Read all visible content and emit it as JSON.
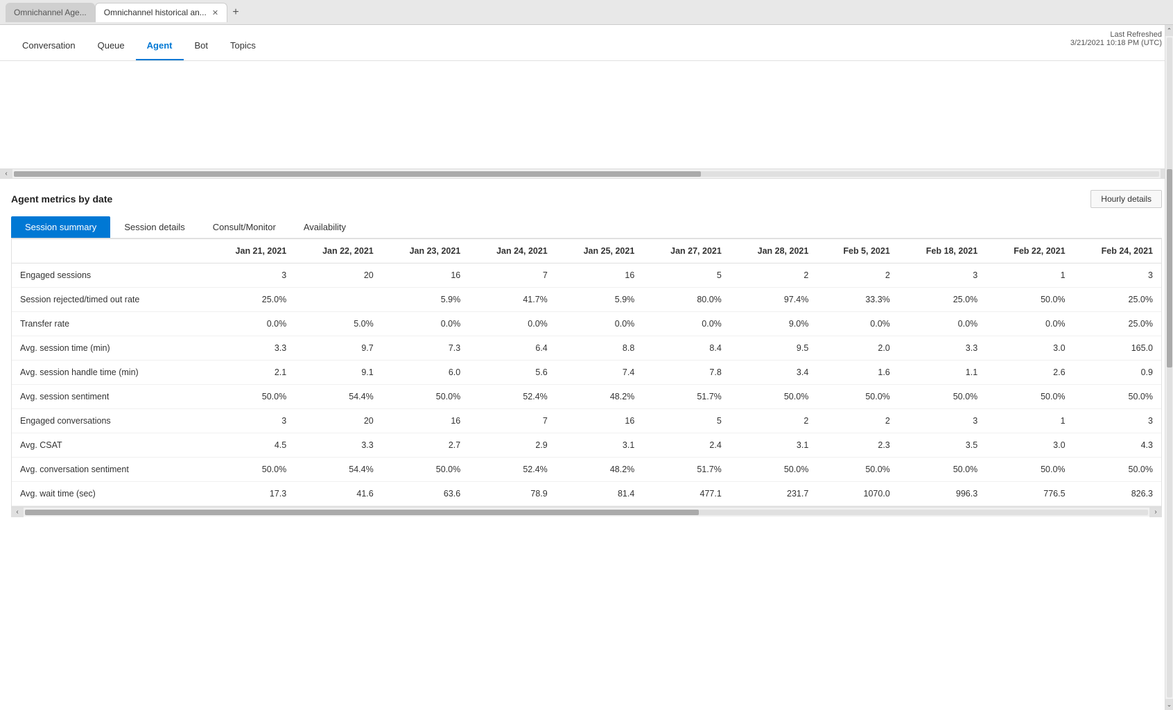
{
  "browser": {
    "tabs": [
      {
        "id": "tab1",
        "label": "Omnichannel Age...",
        "active": false
      },
      {
        "id": "tab2",
        "label": "Omnichannel historical an...",
        "active": true
      }
    ],
    "add_tab_icon": "+"
  },
  "nav": {
    "items": [
      {
        "id": "conversation",
        "label": "Conversation",
        "active": false
      },
      {
        "id": "queue",
        "label": "Queue",
        "active": false
      },
      {
        "id": "agent",
        "label": "Agent",
        "active": true
      },
      {
        "id": "bot",
        "label": "Bot",
        "active": false
      },
      {
        "id": "topics",
        "label": "Topics",
        "active": false
      }
    ],
    "last_refreshed_label": "Last Refreshed",
    "last_refreshed_value": "3/21/2021 10:18 PM (UTC)"
  },
  "agent_metrics": {
    "section_title": "Agent metrics by date",
    "hourly_details_label": "Hourly details",
    "sub_tabs": [
      {
        "id": "session_summary",
        "label": "Session summary",
        "active": true
      },
      {
        "id": "session_details",
        "label": "Session details",
        "active": false
      },
      {
        "id": "consult_monitor",
        "label": "Consult/Monitor",
        "active": false
      },
      {
        "id": "availability",
        "label": "Availability",
        "active": false
      }
    ],
    "table": {
      "columns": [
        "",
        "Jan 21, 2021",
        "Jan 22, 2021",
        "Jan 23, 2021",
        "Jan 24, 2021",
        "Jan 25, 2021",
        "Jan 27, 2021",
        "Jan 28, 2021",
        "Feb 5, 2021",
        "Feb 18, 2021",
        "Feb 22, 2021",
        "Feb 24, 2021"
      ],
      "rows": [
        {
          "metric": "Engaged sessions",
          "values": [
            "3",
            "20",
            "16",
            "7",
            "16",
            "5",
            "2",
            "2",
            "3",
            "1",
            "3"
          ]
        },
        {
          "metric": "Session rejected/timed out rate",
          "values": [
            "25.0%",
            "",
            "5.9%",
            "41.7%",
            "5.9%",
            "80.0%",
            "97.4%",
            "33.3%",
            "25.0%",
            "50.0%",
            "25.0%"
          ]
        },
        {
          "metric": "Transfer rate",
          "values": [
            "0.0%",
            "5.0%",
            "0.0%",
            "0.0%",
            "0.0%",
            "0.0%",
            "9.0%",
            "0.0%",
            "0.0%",
            "0.0%",
            "25.0%"
          ]
        },
        {
          "metric": "Avg. session time (min)",
          "values": [
            "3.3",
            "9.7",
            "7.3",
            "6.4",
            "8.8",
            "8.4",
            "9.5",
            "2.0",
            "3.3",
            "3.0",
            "165.0"
          ]
        },
        {
          "metric": "Avg. session handle time (min)",
          "values": [
            "2.1",
            "9.1",
            "6.0",
            "5.6",
            "7.4",
            "7.8",
            "3.4",
            "1.6",
            "1.1",
            "2.6",
            "0.9"
          ]
        },
        {
          "metric": "Avg. session sentiment",
          "values": [
            "50.0%",
            "54.4%",
            "50.0%",
            "52.4%",
            "48.2%",
            "51.7%",
            "50.0%",
            "50.0%",
            "50.0%",
            "50.0%",
            "50.0%"
          ]
        },
        {
          "metric": "Engaged conversations",
          "values": [
            "3",
            "20",
            "16",
            "7",
            "16",
            "5",
            "2",
            "2",
            "3",
            "1",
            "3"
          ]
        },
        {
          "metric": "Avg. CSAT",
          "values": [
            "4.5",
            "3.3",
            "2.7",
            "2.9",
            "3.1",
            "2.4",
            "3.1",
            "2.3",
            "3.5",
            "3.0",
            "4.3"
          ]
        },
        {
          "metric": "Avg. conversation sentiment",
          "values": [
            "50.0%",
            "54.4%",
            "50.0%",
            "52.4%",
            "48.2%",
            "51.7%",
            "50.0%",
            "50.0%",
            "50.0%",
            "50.0%",
            "50.0%"
          ]
        },
        {
          "metric": "Avg. wait time (sec)",
          "values": [
            "17.3",
            "41.6",
            "63.6",
            "78.9",
            "81.4",
            "477.1",
            "231.7",
            "1070.0",
            "996.3",
            "776.5",
            "826.3"
          ]
        }
      ]
    }
  },
  "colors": {
    "accent": "#0078d4",
    "active_tab_bg": "#0078d4",
    "active_tab_text": "#ffffff"
  }
}
